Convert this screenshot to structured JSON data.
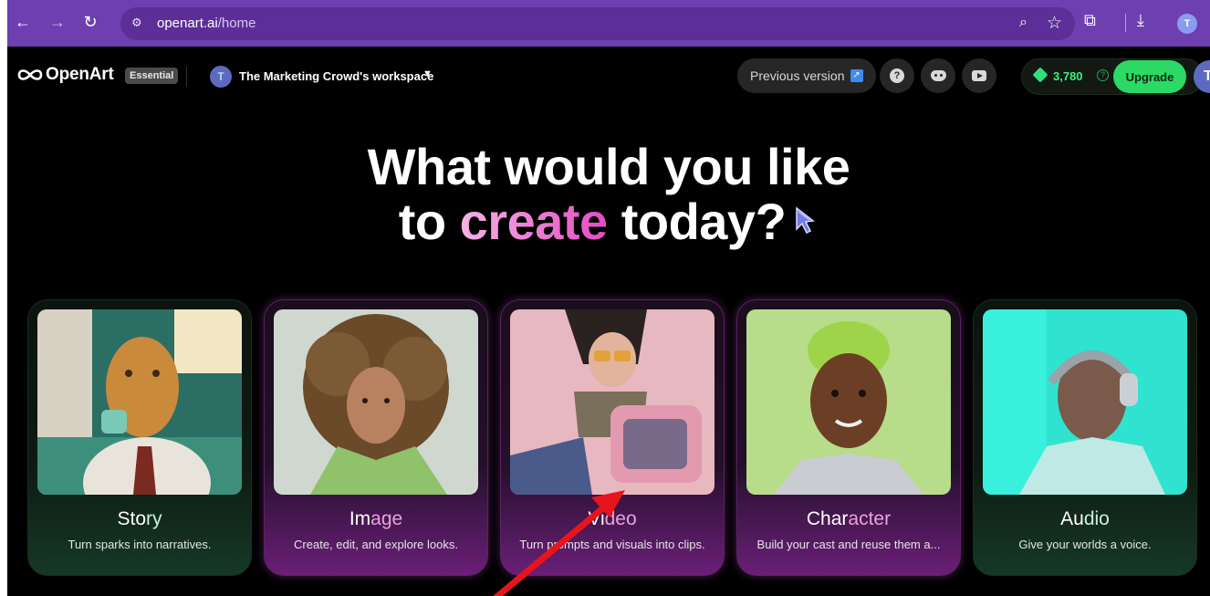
{
  "browser": {
    "url_host": "openart.ai",
    "url_path": "/home",
    "profile_initial": "T"
  },
  "header": {
    "logo_text": "OpenArt",
    "plan_badge": "Essential",
    "workspace_initial": "T",
    "workspace_name": "The Marketing Crowd's workspace",
    "previous_version_label": "Previous version",
    "help_glyph": "?",
    "credits": "3,780",
    "upgrade_label": "Upgrade",
    "user_initial": "T"
  },
  "hero": {
    "line1": "What would you like",
    "line2_pre": "to ",
    "line2_accent": "create",
    "line2_post": " today?"
  },
  "cards": [
    {
      "title_head": "Sto",
      "title_tail": "ry",
      "desc": "Turn sparks into narratives.",
      "style": "green"
    },
    {
      "title_head": "Im",
      "title_tail": "age",
      "desc": "Create, edit, and explore looks.",
      "style": "pink"
    },
    {
      "title_head": "Vi",
      "title_tail": "deo",
      "desc": "Turn prompts and visuals into clips.",
      "style": "pink"
    },
    {
      "title_head": "Char",
      "title_tail": "acter",
      "desc": "Build your cast and reuse them a...",
      "style": "pink"
    },
    {
      "title_head": "Au",
      "title_tail": "dio",
      "desc": "Give your worlds a voice.",
      "style": "green"
    }
  ],
  "colors": {
    "browser_chrome": "#6e3fb0",
    "upgrade_green": "#2bd964",
    "credits_green": "#3cf07e",
    "accent_pink": "#e54bc4",
    "annotation_arrow": "#e8141c"
  }
}
